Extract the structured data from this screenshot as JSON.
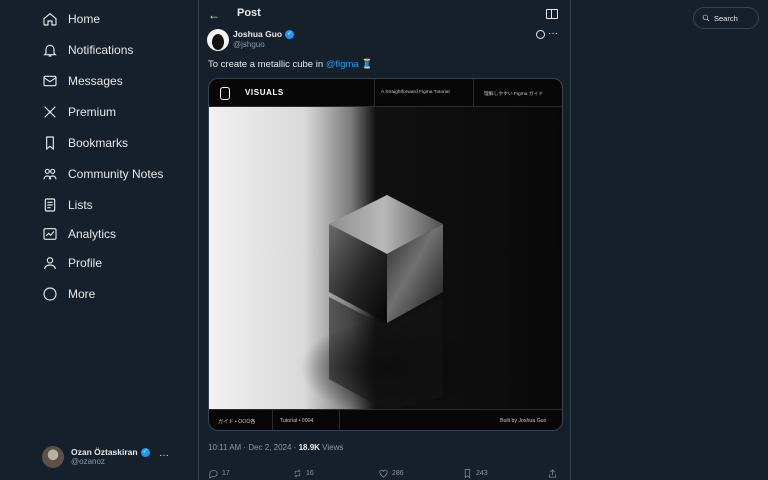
{
  "nav": [
    {
      "label": "Home",
      "icon": "home-icon"
    },
    {
      "label": "Notifications",
      "icon": "bell-icon"
    },
    {
      "label": "Messages",
      "icon": "mail-icon"
    },
    {
      "label": "Premium",
      "icon": "x-logo-icon"
    },
    {
      "label": "Bookmarks",
      "icon": "bookmark-icon"
    },
    {
      "label": "Community Notes",
      "icon": "people-icon"
    },
    {
      "label": "Lists",
      "icon": "list-icon"
    },
    {
      "label": "Analytics",
      "icon": "chart-icon"
    },
    {
      "label": "Profile",
      "icon": "user-icon"
    },
    {
      "label": "More",
      "icon": "more-circle-icon"
    }
  ],
  "account": {
    "name": "Ozan Öztaskiran",
    "handle": "@ozanoz",
    "more": "···"
  },
  "header": {
    "back": "←",
    "title": "Post"
  },
  "post": {
    "name": "Joshua Guo",
    "handle": "@jshguo",
    "more": "···",
    "text_prefix": "To create a metallic cube in ",
    "mention": "@figma",
    "emoji": "🧵",
    "card": {
      "brand": "VISUALS",
      "tag_left": "A Straightforward Figma Tutorial",
      "tag_right": "理解しやすい Figma ガイド",
      "footer_left": "ガイド • OOO各",
      "footer_mid": "Tutorial • 0004",
      "footer_right": "Built by Joshua Guo"
    },
    "time": "10:11 AM · Dec 2, 2024 · ",
    "views_count": "18.9K",
    "views_label": "Views",
    "replies": "17",
    "reposts": "16",
    "likes": "286",
    "bookmarks": "243"
  },
  "search": {
    "placeholder": "Search"
  },
  "colors": {
    "background": "#15202b",
    "accent": "#1d9bf0",
    "border": "#38444d"
  }
}
